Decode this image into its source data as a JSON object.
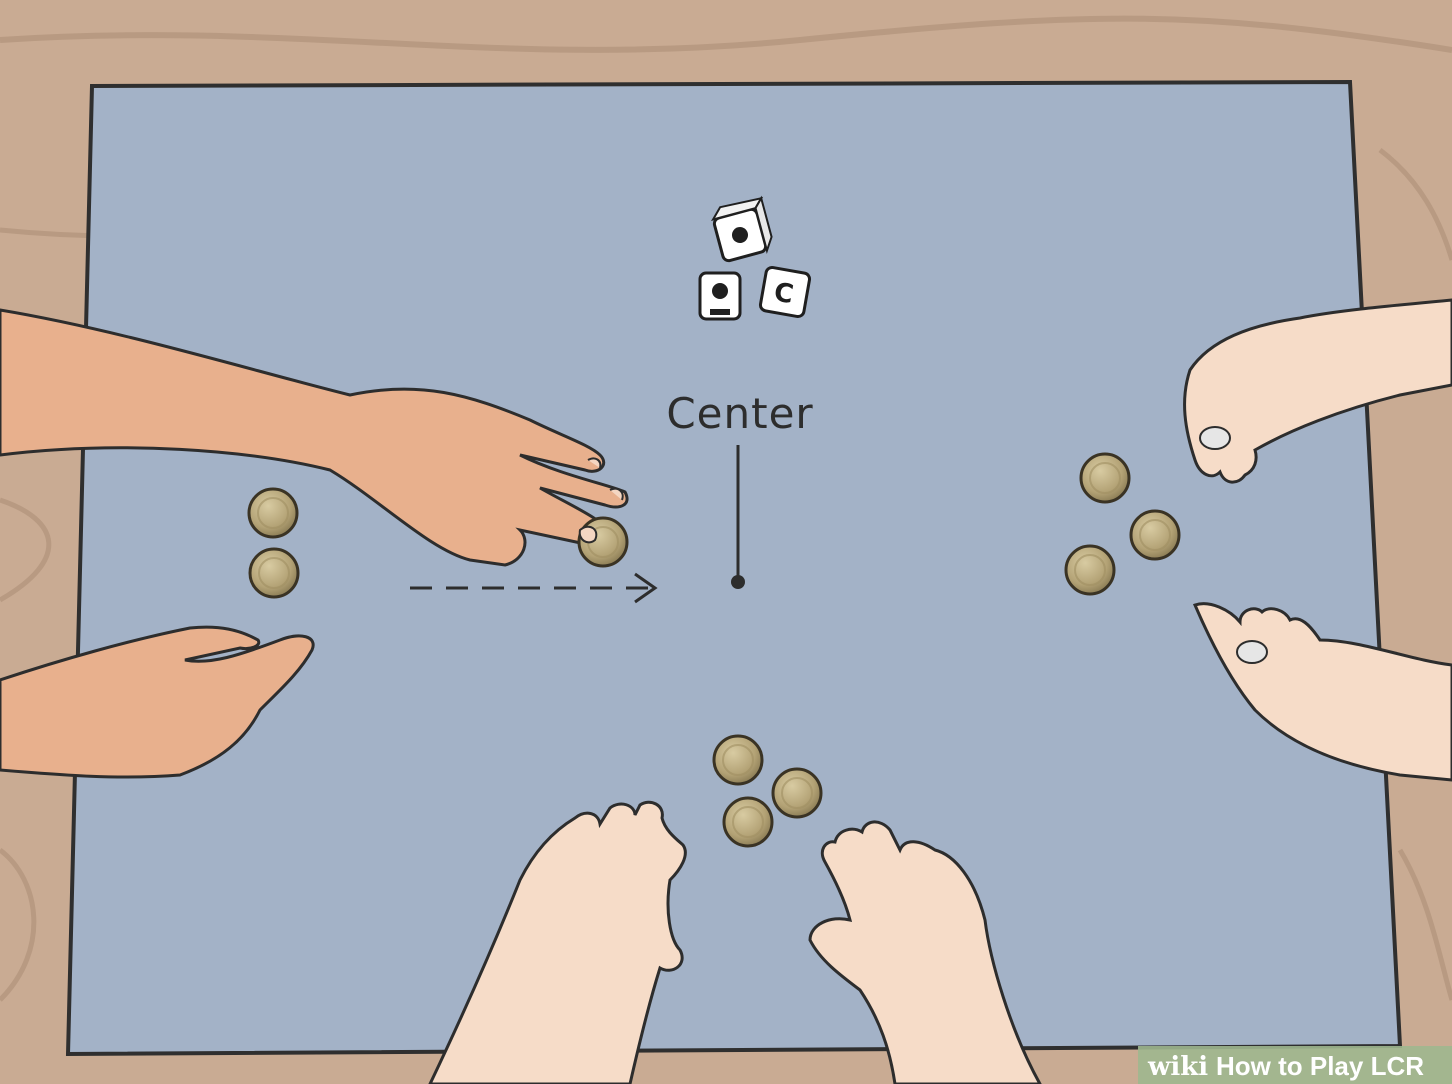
{
  "scene": {
    "center_label": "Center",
    "watermark": {
      "brand": "wiki",
      "title": "How to Play LCR"
    },
    "dice": [
      {
        "face": "dot"
      },
      {
        "face": "dot"
      },
      {
        "face": "C"
      }
    ],
    "chips": {
      "left_player": 3,
      "right_player": 3,
      "bottom_player": 3
    },
    "colors": {
      "table": "#a3b2c7",
      "wood": "#c9ab93",
      "chip": "#b6a578",
      "skin_tan": "#e8b08d",
      "skin_light": "#f6dcc8",
      "watermark_bg": "#9fb78f"
    }
  }
}
